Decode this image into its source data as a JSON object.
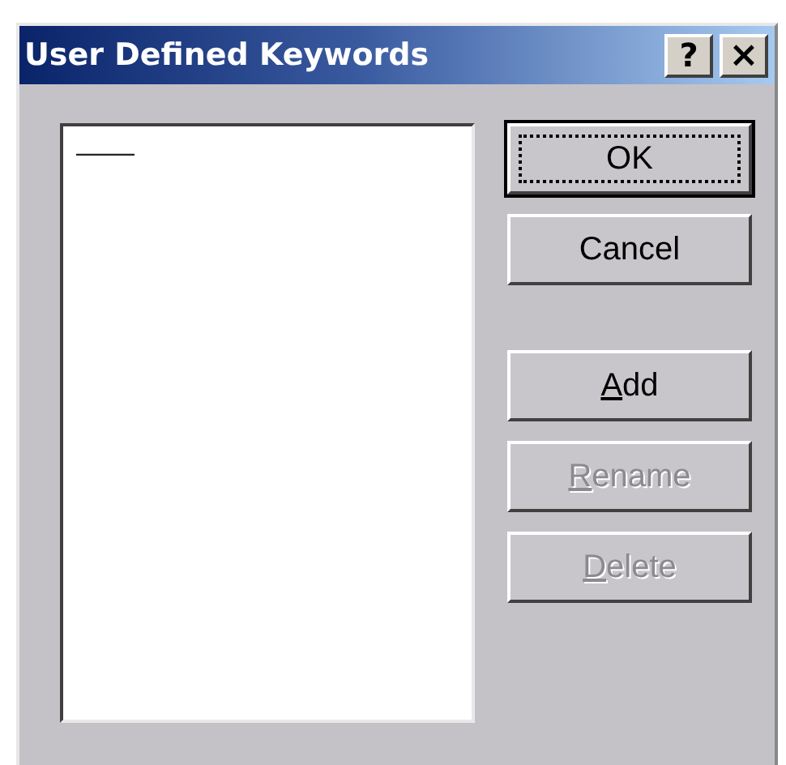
{
  "window": {
    "title": "User Defined Keywords",
    "title_buttons": [
      {
        "kind": "help",
        "label": "?"
      },
      {
        "kind": "close",
        "label": "×"
      }
    ]
  },
  "keyword_list": {
    "items": [
      {
        "text": "——",
        "selected": false
      }
    ]
  },
  "buttons": [
    {
      "label": "OK",
      "default": true,
      "focused": true,
      "disabled": false,
      "underline_first": false
    },
    {
      "label": "Cancel",
      "default": false,
      "focused": false,
      "disabled": false,
      "underline_first": false
    },
    {
      "label": "Add",
      "default": false,
      "focused": false,
      "disabled": false,
      "underline_first": true
    },
    {
      "label": "Rename",
      "default": false,
      "focused": false,
      "disabled": true,
      "underline_first": true
    },
    {
      "label": "Delete",
      "default": false,
      "focused": false,
      "disabled": true,
      "underline_first": true
    }
  ]
}
